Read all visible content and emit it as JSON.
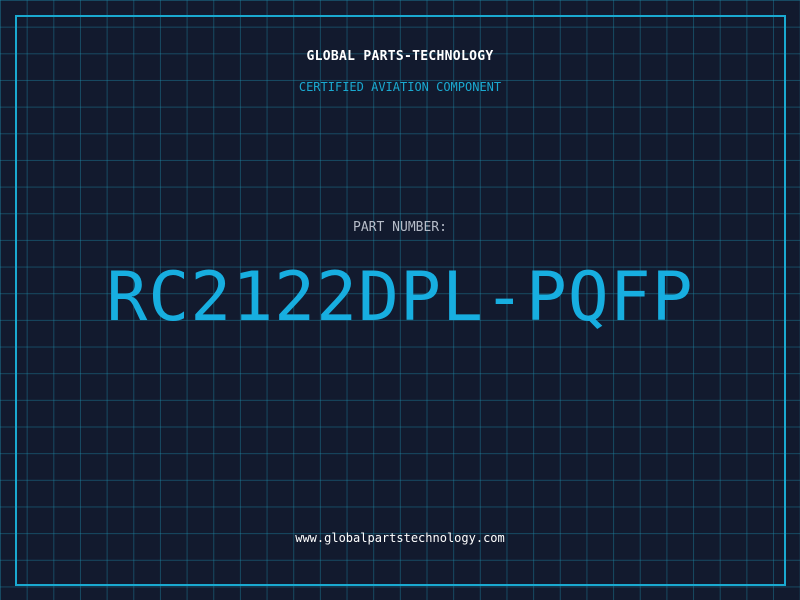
{
  "header": {
    "company": "GLOBAL PARTS-TECHNOLOGY",
    "tagline": "CERTIFIED AVIATION COMPONENT"
  },
  "part": {
    "label": "PART NUMBER:",
    "number": "RC2122DPL-PQFP"
  },
  "footer": {
    "website": "www.globalpartstechnology.com"
  },
  "colors": {
    "background": "#121a2e",
    "accent": "#1aa9d0",
    "part_number": "#17aee0",
    "text_light": "#ffffff"
  }
}
